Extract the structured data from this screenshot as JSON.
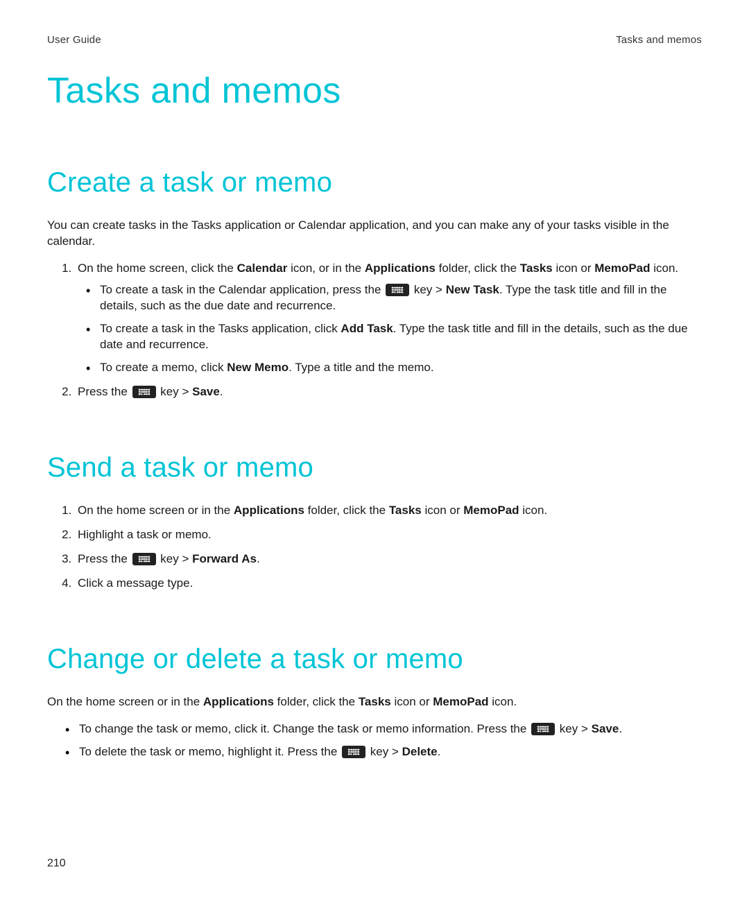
{
  "header": {
    "left": "User Guide",
    "right": "Tasks and memos"
  },
  "chapter_title": "Tasks and memos",
  "sections": {
    "create": {
      "title": "Create a task or memo",
      "intro": "You can create tasks in the Tasks application or Calendar application, and you can make any of your tasks visible in the calendar.",
      "step1": {
        "pre": "On the home screen, click the ",
        "b_calendar": "Calendar",
        "after_calendar": " icon, or in the ",
        "b_applications": "Applications",
        "after_applications": " folder, click the ",
        "b_tasks": "Tasks",
        "after_tasks": " icon or ",
        "b_memopad": "MemoPad",
        "after_memopad": " icon."
      },
      "bullets": {
        "b1": {
          "pre": "To create a task in the Calendar application, press the ",
          "key_gt": " key > ",
          "b_new_task": "New Task",
          "after": ". Type the task title and fill in the details, such as the due date and recurrence."
        },
        "b2": {
          "pre": "To create a task in the Tasks application, click ",
          "b_add_task": "Add Task",
          "after": ". Type the task title and fill in the details, such as the due date and recurrence."
        },
        "b3": {
          "pre": "To create a memo, click ",
          "b_new_memo": "New Memo",
          "after": ". Type a title and the memo."
        }
      },
      "step2": {
        "pre": "Press the ",
        "key_gt": " key > ",
        "b_save": "Save",
        "after": "."
      }
    },
    "send": {
      "title": "Send a task or memo",
      "step1": {
        "pre": "On the home screen or in the ",
        "b_applications": "Applications",
        "after_applications": " folder, click the ",
        "b_tasks": "Tasks",
        "after_tasks": " icon or ",
        "b_memopad": "MemoPad",
        "after_memopad": " icon."
      },
      "step2": "Highlight a task or memo.",
      "step3": {
        "pre": "Press the ",
        "key_gt": " key > ",
        "b_forward": "Forward As",
        "after": "."
      },
      "step4": "Click a message type."
    },
    "change": {
      "title": "Change or delete a task or memo",
      "intro": {
        "pre": "On the home screen or in the ",
        "b_applications": "Applications",
        "after_applications": " folder, click the ",
        "b_tasks": "Tasks",
        "after_tasks": " icon or ",
        "b_memopad": "MemoPad",
        "after_memopad": " icon."
      },
      "bullets": {
        "b1": {
          "pre": "To change the task or memo, click it. Change the task or memo information. Press the ",
          "key_gt": " key > ",
          "b_save": "Save",
          "after": "."
        },
        "b2": {
          "pre": "To delete the task or memo, highlight it. Press the ",
          "key_gt": " key > ",
          "b_delete": "Delete",
          "after": "."
        }
      }
    }
  },
  "page_number": "210"
}
